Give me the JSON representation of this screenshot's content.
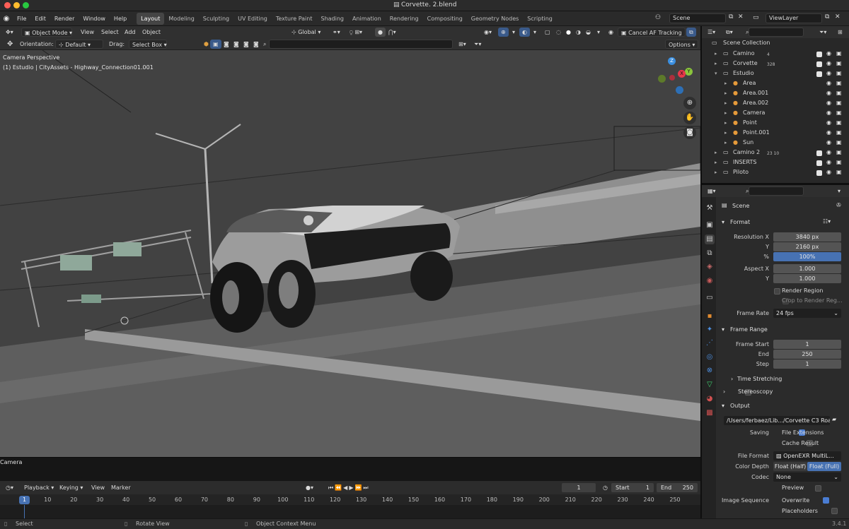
{
  "window": {
    "title": "Corvette. 2.blend"
  },
  "menubar": {
    "items": [
      "File",
      "Edit",
      "Render",
      "Window",
      "Help"
    ]
  },
  "workspaces": [
    "Layout",
    "Modeling",
    "Sculpting",
    "UV Editing",
    "Texture Paint",
    "Shading",
    "Animation",
    "Rendering",
    "Compositing",
    "Geometry Nodes",
    "Scripting"
  ],
  "active_workspace": "Layout",
  "scene_selector": {
    "value": "Scene"
  },
  "viewlayer_selector": {
    "value": "ViewLayer"
  },
  "viewport_header": {
    "mode": "Object Mode",
    "menus": [
      "View",
      "Select",
      "Add",
      "Object"
    ],
    "transform_orientation": "Global",
    "cancel_af": "Cancel AF Tracking",
    "orientation_label": "Orientation:",
    "orientation_value": "Default",
    "drag_label": "Drag:",
    "drag_value": "Select Box",
    "options": "Options"
  },
  "viewport": {
    "perspective_label": "Camera Perspective",
    "context_label": "(1) Estudio | CityAssets - Highway_Connection01.001",
    "camera_name_label": "Camera",
    "gizmo": {
      "z": "Z",
      "y": "Y",
      "x": "X"
    }
  },
  "outliner": {
    "root": "Scene Collection",
    "items": [
      {
        "name": "Camino",
        "badge": "4",
        "indent": 0
      },
      {
        "name": "Corvette",
        "badge": "328",
        "indent": 0
      },
      {
        "name": "Estudio",
        "badge": "",
        "indent": 0
      },
      {
        "name": "Area",
        "badge": "",
        "indent": 1
      },
      {
        "name": "Area.001",
        "badge": "",
        "indent": 1
      },
      {
        "name": "Area.002",
        "badge": "",
        "indent": 1
      },
      {
        "name": "Camera",
        "badge": "",
        "indent": 1
      },
      {
        "name": "Point",
        "badge": "",
        "indent": 1
      },
      {
        "name": "Point.001",
        "badge": "",
        "indent": 1
      },
      {
        "name": "Sun",
        "badge": "",
        "indent": 1
      },
      {
        "name": "Camino 2",
        "badge": "23  10",
        "indent": 0
      },
      {
        "name": "INSERTS",
        "badge": "",
        "indent": 0
      },
      {
        "name": "Piloto",
        "badge": "",
        "indent": 0
      }
    ]
  },
  "properties": {
    "context": "Scene",
    "format": {
      "header": "Format",
      "resolution_x_label": "Resolution X",
      "resolution_x": "3840 px",
      "resolution_y_label": "Y",
      "resolution_y": "2160 px",
      "percent_label": "%",
      "percent": "100%",
      "aspect_x_label": "Aspect X",
      "aspect_x": "1.000",
      "aspect_y_label": "Y",
      "aspect_y": "1.000",
      "render_region": "Render Region",
      "crop_region": "Crop to Render Reg...",
      "frame_rate_label": "Frame Rate",
      "frame_rate": "24 fps"
    },
    "frame_range": {
      "header": "Frame Range",
      "start_label": "Frame Start",
      "start": "1",
      "end_label": "End",
      "end": "250",
      "step_label": "Step",
      "step": "1",
      "time_stretching": "Time Stretching"
    },
    "stereoscopy": "Stereoscopy",
    "output": {
      "header": "Output",
      "path": "/Users/ferbaez/Lib.../Corvette C3 Road",
      "saving_label": "Saving",
      "file_extensions": "File Extensions",
      "cache_result": "Cache Result",
      "file_format_label": "File Format",
      "file_format": "OpenEXR MultiL...",
      "color_depth_label": "Color Depth",
      "depth_half": "Float (Half)",
      "depth_full": "Float (Full)",
      "codec_label": "Codec",
      "codec": "None",
      "preview": "Preview",
      "image_sequence_label": "Image Sequence",
      "overwrite": "Overwrite",
      "placeholders": "Placeholders"
    }
  },
  "timeline": {
    "menus": [
      "Playback",
      "Keying",
      "View",
      "Marker"
    ],
    "current_frame": "1",
    "start_label": "Start",
    "start": "1",
    "end_label": "End",
    "end": "250",
    "playhead": "1",
    "ticks": [
      "10",
      "20",
      "30",
      "40",
      "50",
      "60",
      "70",
      "80",
      "90",
      "100",
      "110",
      "120",
      "130",
      "140",
      "150",
      "160",
      "170",
      "180",
      "190",
      "200",
      "210",
      "220",
      "230",
      "240",
      "250"
    ]
  },
  "statusbar": {
    "select": "Select",
    "rotate": "Rotate View",
    "context_menu": "Object Context Menu",
    "version": "3.4.1"
  },
  "colors": {
    "accent": "#4772b3",
    "viewport_bg": "#424242",
    "gizmo_x": "#e8374a",
    "gizmo_y": "#8ac43c",
    "gizmo_z": "#3a8fe0"
  }
}
